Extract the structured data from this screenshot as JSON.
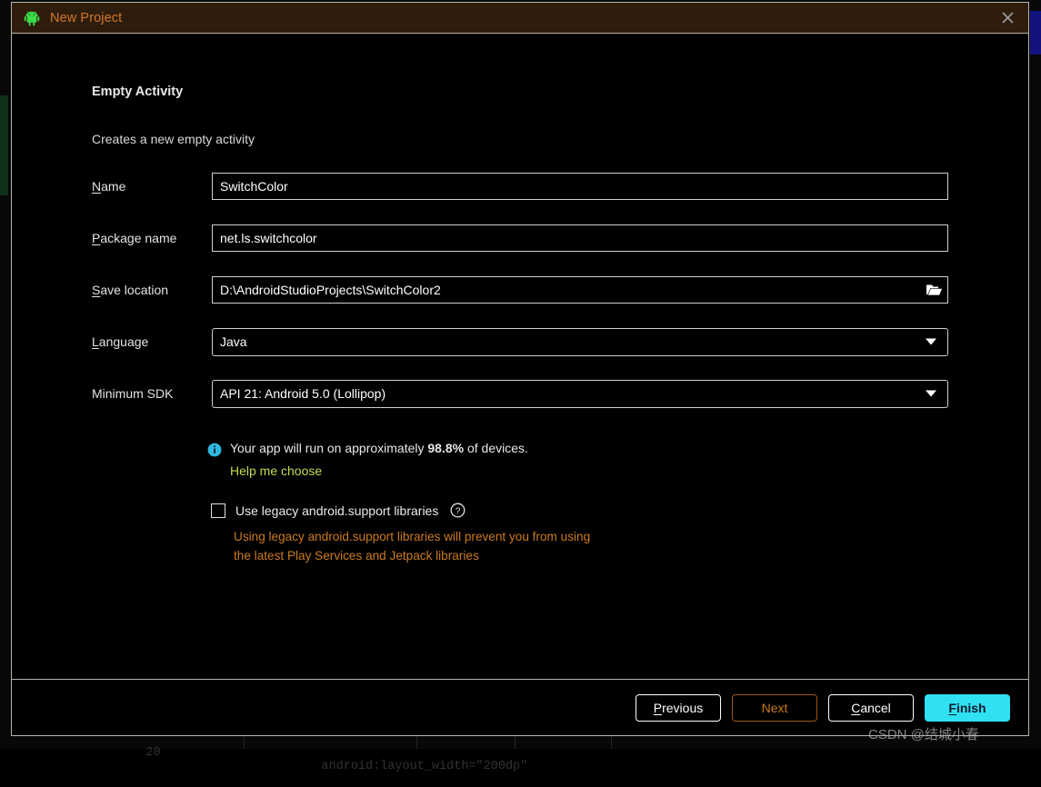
{
  "window": {
    "title": "New Project",
    "app_icon": "android-robot-icon",
    "close_icon": "close-icon"
  },
  "step": {
    "title": "Empty Activity",
    "description": "Creates a new empty activity"
  },
  "form": {
    "fields": [
      {
        "label_prefix": "",
        "mnemonic": "N",
        "label_suffix": "ame",
        "value": "SwitchColor",
        "type": "text",
        "name": "name"
      },
      {
        "label_prefix": "",
        "mnemonic": "P",
        "label_suffix": "ackage name",
        "value": "net.ls.switchcolor",
        "type": "text",
        "name": "package-name"
      },
      {
        "label_prefix": "",
        "mnemonic": "S",
        "label_suffix": "ave location",
        "value": "D:\\AndroidStudioProjects\\SwitchColor2",
        "type": "text-with-browse",
        "browse_icon": "folder-icon",
        "name": "save-location"
      },
      {
        "label_prefix": "",
        "mnemonic": "L",
        "label_suffix": "anguage",
        "value": "Java",
        "type": "combo",
        "name": "language"
      },
      {
        "label_prefix": "Minimum SDK",
        "mnemonic": "",
        "label_suffix": "",
        "value": "API 21: Android 5.0 (Lollipop)",
        "type": "combo",
        "name": "minimum-sdk"
      }
    ]
  },
  "info": {
    "icon": "info-icon",
    "text_before": "Your app will run on approximately ",
    "percentage": "98.8%",
    "text_after": " of devices.",
    "help_link": "Help me choose",
    "link_color": "#c5d94f",
    "icon_color": "#2fb8e0"
  },
  "legacy": {
    "checked": false,
    "label": "Use legacy android.support libraries",
    "help_icon": "question-mark-icon",
    "warning_line1": "Using legacy android.support libraries will prevent you from using",
    "warning_line2": "the latest Play Services and Jetpack libraries",
    "warning_color": "#cb7a1e"
  },
  "footer": {
    "buttons": [
      {
        "prefix": "",
        "mnemonic": "P",
        "suffix": "revious",
        "style": "default",
        "name": "previous"
      },
      {
        "prefix": "",
        "mnemonic": "",
        "suffix": "Next",
        "style": "next",
        "name": "next"
      },
      {
        "prefix": "",
        "mnemonic": "C",
        "suffix": "ancel",
        "style": "default",
        "name": "cancel"
      },
      {
        "prefix": "",
        "mnemonic": "F",
        "suffix": "inish",
        "style": "finish",
        "name": "finish"
      }
    ]
  },
  "watermark": {
    "text": "CSDN @结城小春"
  },
  "background": {
    "code_line": "          android:layout_width=\"200dp\"",
    "line_number": "20"
  },
  "colors": {
    "titlebar_bg": "#2e1d0c",
    "titlebar_text": "#d4772a",
    "android_green": "#3ddc4a",
    "finish_bg": "#2fe1f2",
    "dialog_border": "#b9b3a8"
  }
}
